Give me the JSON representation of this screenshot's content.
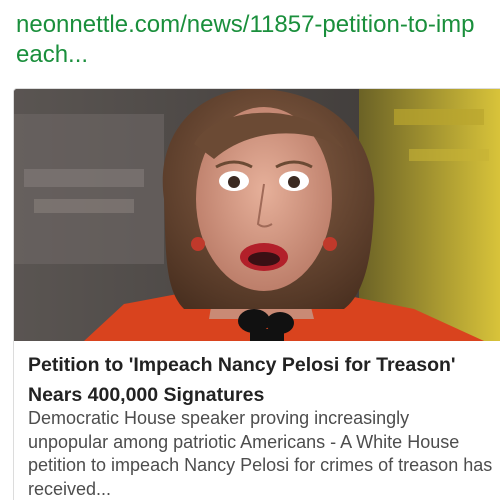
{
  "link": {
    "url_text": "neonnettle.com/news/11857-petition-to-impeach..."
  },
  "article": {
    "headline": "Petition to 'Impeach Nancy Pelosi for Treason' Nears 400,000 Signatures",
    "snippet": "Democratic House speaker proving increasingly unpopular among patriotic Americans - A White House petition to impeach Nancy Pelosi for crimes of treason has received..."
  },
  "colors": {
    "link": "#1a8f3c",
    "headline": "#222222",
    "snippet": "#4d4d4d"
  }
}
